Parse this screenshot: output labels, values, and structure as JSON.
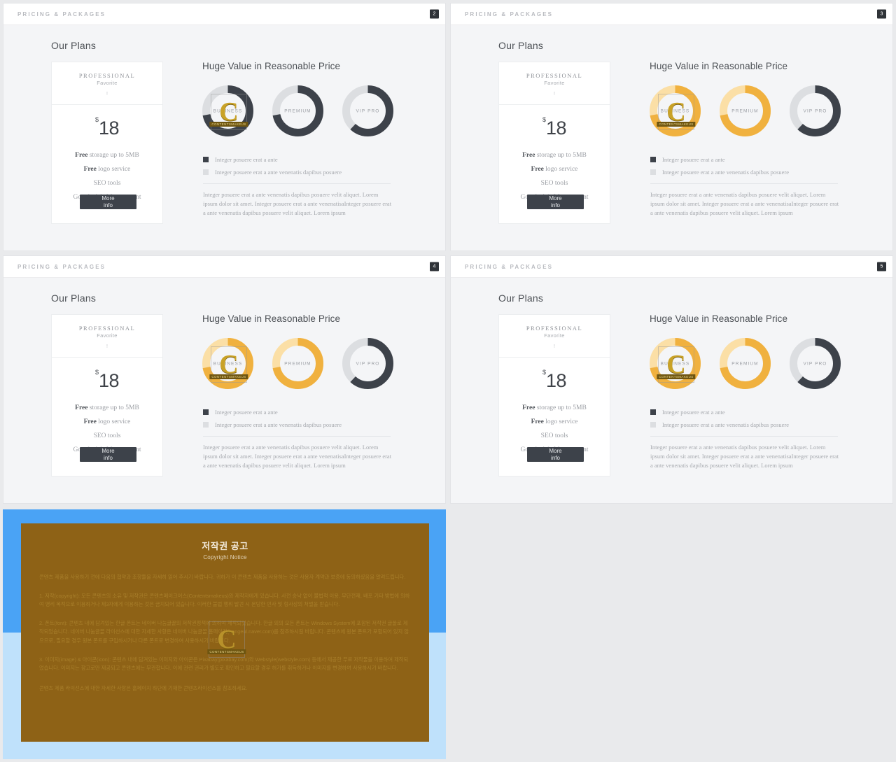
{
  "header": {
    "title": "PRICING & PACKAGES"
  },
  "panels": [
    {
      "badge": "2",
      "theme": "dark"
    },
    {
      "badge": "3",
      "theme": "orange"
    },
    {
      "badge": "4",
      "theme": "orange"
    },
    {
      "badge": "5",
      "theme": "orange"
    }
  ],
  "slide": {
    "our_plans": "Our Plans",
    "section_title": "Huge Value in Reasonable Price",
    "card": {
      "plan_name": "PROFESSIONAL",
      "favorite": "Favorite",
      "tick": "!",
      "currency": "$",
      "price": "18",
      "features": [
        {
          "strong": "Free",
          "rest": "storage up to 5MB"
        },
        {
          "strong": "Free",
          "rest": "logo service"
        },
        {
          "strong": "",
          "rest": "SEO tools"
        },
        {
          "strong": "",
          "rest": "Google Ads Management"
        }
      ],
      "button_line1": "More",
      "button_line2": "info"
    },
    "legend": [
      {
        "label": "Integer posuere erat a ante",
        "color": "#3d424a"
      },
      {
        "label": "Integer posuere erat a ante venenatis dapibus posuere",
        "color": "#dcdee1"
      }
    ],
    "blurb": "Integer posuere erat a ante venenatis dapibus posuere velit aliquet. Lorem ipsum dolor sit amet. Integer posuere erat a ante venenatisaInteger posuere erat a ante venenatis dapibus posuere velit aliquet. Lorem ipsum"
  },
  "chart_data": {
    "type": "pie",
    "title": "Huge Value in Reasonable Price",
    "legend_position": "below",
    "charts": [
      {
        "label": "BUSINESS",
        "value": 72,
        "remainder": 28
      },
      {
        "label": "PREMIUM",
        "value": 72,
        "remainder": 28
      },
      {
        "label": "VIP PRO",
        "value": 62,
        "remainder": 38
      }
    ],
    "themes": {
      "dark": {
        "fill": "#3d424a",
        "track": "#dcdee1"
      },
      "orange": {
        "fill": "#f0b13f",
        "track": "#fbdfa6"
      },
      "orange_alt": {
        "fill": "#3d424a",
        "track": "#dcdee1"
      }
    }
  },
  "copyright": {
    "title": "저작권 공고",
    "subtitle": "Copyright Notice",
    "lead": "콘텐츠 제품을 사용하기 전에 다음의 협약과 조항들을 자세히 읽어 주시기 바랍니다. 귀하가 이 콘텐츠 제품을 사용하는 것은 사용자 계약과 보증에 동의하셨음을 알려드립니다.",
    "item1": "1. 저작(copyright): 모든 콘텐츠의 소유 및 저작권은 콘텐츠메이크어스(Contentsmakeus)와 제작자에게 있습니다. 사전 승낙 없이 불법적 이용, 무단전재, 배포 기타 방법에 의하여 영리 목적으로 이용하거나 제3자에게 이용하는 것은 금지되어 있습니다. 이러한 불법 행위 발견 시 온당한 민사 및 형사상의 처벌을 받습니다.",
    "item2": "2. 폰트(font): 콘텐츠 내에 담겨있는 한글 폰트는 네이버 나눔글꼴의 저작권정책에 의하여 제작되었습니다. 한글 외의 모든 폰트는 Windows System에 포함된 저작권 글꼴로 제작되었습니다. 네이버 나눔글꼴 라이선스에 대한 자세한 사항은 네이버 나눔글꼴 홈페이지(hangeul.naver.com)를 참조하시길 바랍니다. 콘텐츠에 원본 폰트가 포함되어 있지 않으므로, 필요할 경우 원본 폰트를 구입하시거나 다른 폰트로 변경하여 사용하시기 바랍니다.",
    "item3": "3. 이미지(image) & 아이콘(icon): 콘텐츠 내에 담겨있는 이미지와 아이콘은 Pixabay(pixabay.com)와 Webstyle(webstyle.com) 등에서 제공한 무료 저작물을 이용하여 제작되었습니다. 이미지는 참고로만 제공되고 콘텐츠에는 무관합니다. 이에 관련 권리가 별도로 확인하고 필요할 경우 허가를 취득하거나 이미지를 변경하여 사용하시기 바랍니다.",
    "last": "콘텐츠 제품 라이선스에 대한 자세한 사항은 홈페이지 하단에 기재한 콘텐츠라이선스를 참조하세요."
  },
  "watermark": {
    "letter": "C",
    "tag": "CONTENTSMAKEUS"
  }
}
